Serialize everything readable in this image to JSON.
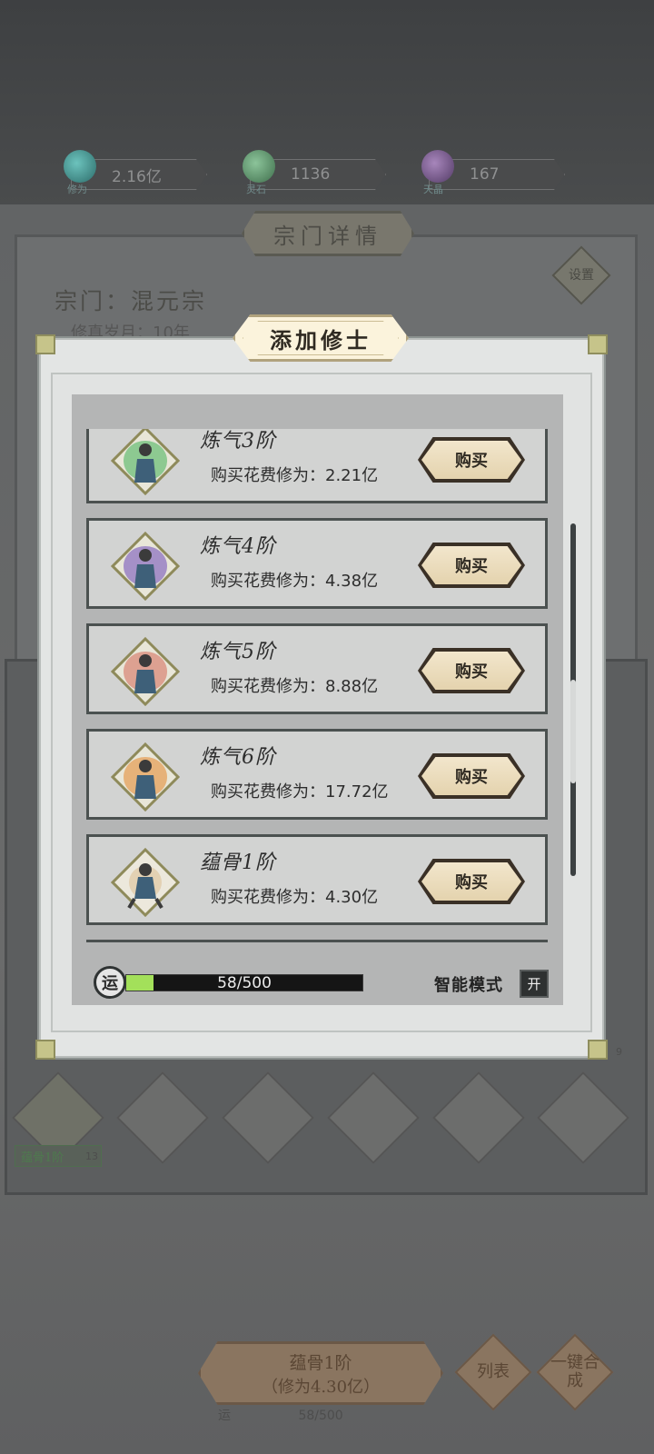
{
  "resources": [
    {
      "name": "修为",
      "value": "2.16亿",
      "icon": "cultivation-orb-icon",
      "color": "#3f9e9a"
    },
    {
      "name": "灵石",
      "value": "1136",
      "icon": "spirit-stone-icon",
      "color": "#5f9a6e"
    },
    {
      "name": "天晶",
      "value": "167",
      "icon": "sky-crystal-icon",
      "color": "#7d5a93"
    }
  ],
  "sect": {
    "title": "宗门详情",
    "settings_label": "设置",
    "name": "宗门：混元宗",
    "years": "修真岁月：10年"
  },
  "slots": {
    "first_label": "蕴骨1阶",
    "first_count": "13",
    "side_number": "9"
  },
  "bottom": {
    "main_line1": "蕴骨1阶",
    "main_line2": "（修为4.30亿）",
    "list_label": "列表",
    "merge_label": "一键合成",
    "luck_icon": "运",
    "luck_text": "58/500"
  },
  "modal": {
    "title": "添加修士",
    "cultivators": [
      {
        "rank": "炼气3阶",
        "cost": "购买花费修为：2.21亿",
        "buy_label": "购买",
        "aura": "#6fbf7a"
      },
      {
        "rank": "炼气4阶",
        "cost": "购买花费修为：4.38亿",
        "buy_label": "购买",
        "aura": "#8f73c2"
      },
      {
        "rank": "炼气5阶",
        "cost": "购买花费修为：8.88亿",
        "buy_label": "购买",
        "aura": "#d98a7a"
      },
      {
        "rank": "炼气6阶",
        "cost": "购买花费修为：17.72亿",
        "buy_label": "购买",
        "aura": "#e6a05a"
      },
      {
        "rank": "蕴骨1阶",
        "cost": "购买花费修为：4.30亿",
        "buy_label": "购买",
        "aura": "#d9b98a"
      }
    ],
    "luck": {
      "icon_label": "运",
      "current": 58,
      "max": 500,
      "text": "58/500"
    },
    "smart_mode": {
      "label": "智能模式",
      "state": "开"
    }
  }
}
